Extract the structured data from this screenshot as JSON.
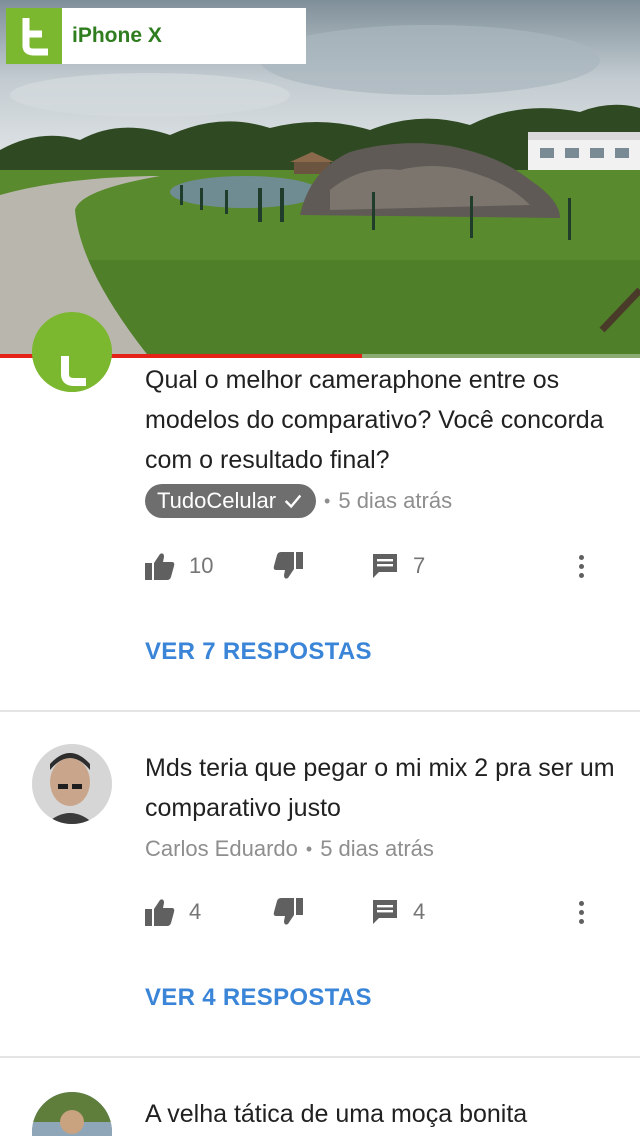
{
  "player": {
    "watermark_label": "iPhone X",
    "progress_fraction": 0.565,
    "colors": {
      "progress": "#e62117",
      "brand": "#7cb82f"
    }
  },
  "comments": [
    {
      "text": "Qual o melhor cameraphone entre os modelos do comparativo? Você concorda com o resultado final?",
      "author": "TudoCelular",
      "verified": true,
      "time": "5 dias atrás",
      "likes": "10",
      "reply_count": "7",
      "replies_label": "VER 7 RESPOSTAS"
    },
    {
      "text": "Mds teria que pegar o mi mix 2 pra ser um comparativo justo",
      "author": "Carlos Eduardo",
      "time": "5 dias atrás",
      "likes": "4",
      "reply_count": "4",
      "replies_label": "VER 4 RESPOSTAS"
    },
    {
      "text": "A velha tática de uma moça bonita"
    }
  ],
  "icons": [
    "thumbs-up-icon",
    "thumbs-down-icon",
    "reply-icon",
    "more-vert-icon",
    "check-icon"
  ]
}
